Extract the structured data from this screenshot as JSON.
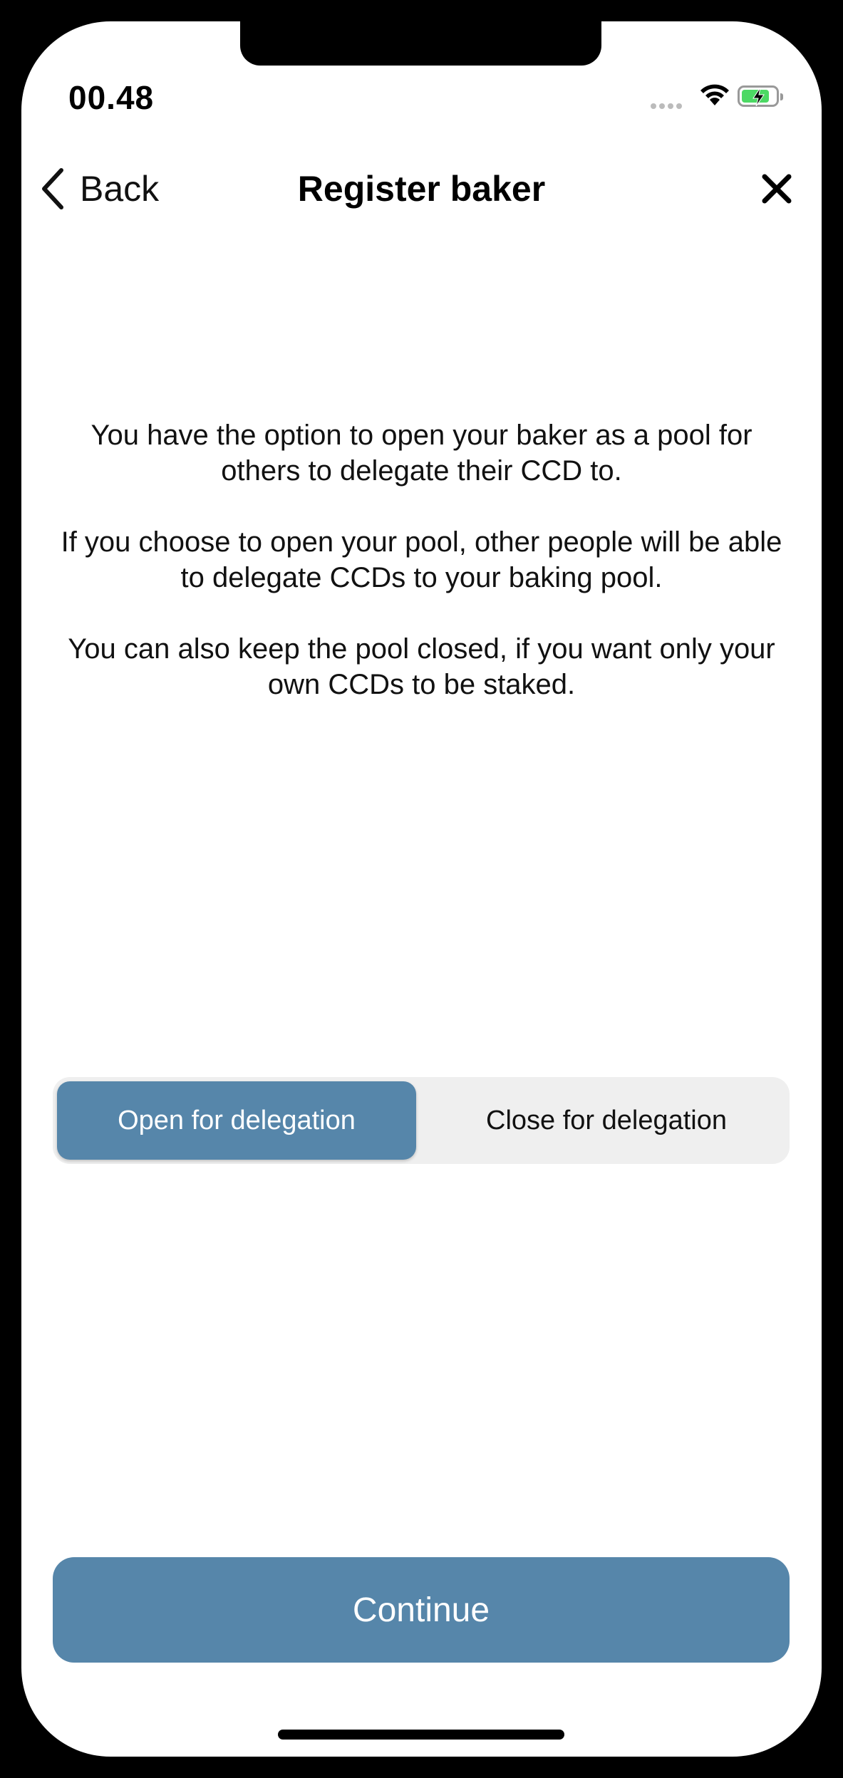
{
  "status_bar": {
    "time": "00.48"
  },
  "nav": {
    "back_label": "Back",
    "title": "Register baker"
  },
  "description": {
    "p1": "You have the option to open your baker as a pool for others to delegate their CCD to.",
    "p2": "If you choose to open your pool, other people will be able to delegate CCDs to your baking pool.",
    "p3": "You can also keep the pool closed, if you want only your own CCDs to be staked."
  },
  "segmented": {
    "options": [
      {
        "label": "Open for delegation",
        "selected": true
      },
      {
        "label": "Close for delegation",
        "selected": false
      }
    ]
  },
  "actions": {
    "continue_label": "Continue"
  },
  "colors": {
    "accent": "#5686aa",
    "segment_bg": "#efefef",
    "battery": "#4cd964"
  },
  "icons": [
    "chevron-left-icon",
    "close-icon",
    "wifi-icon",
    "battery-charging-icon",
    "cellular-signal-icon"
  ]
}
